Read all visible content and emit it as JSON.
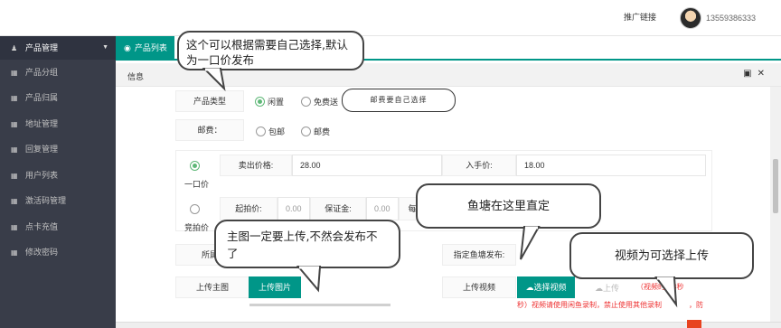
{
  "header": {
    "promo_link": "推广链接",
    "phone": "13559386333"
  },
  "sidebar": {
    "head": "产品管理",
    "items": [
      {
        "label": "产品分组"
      },
      {
        "label": "产品归属"
      },
      {
        "label": "地址管理"
      },
      {
        "label": "回复管理"
      },
      {
        "label": "用户列表"
      },
      {
        "label": "激活码管理"
      },
      {
        "label": "点卡充值"
      },
      {
        "label": "修改密码"
      }
    ]
  },
  "tabs": {
    "active": "产品列表"
  },
  "panel": {
    "title": "信息"
  },
  "form": {
    "product_type": {
      "label": "产品类型",
      "options": [
        "闲置",
        "免费送"
      ],
      "selected": "闲置"
    },
    "postage_button": "邮费要自己选择",
    "postage": {
      "label": "邮费：",
      "options": [
        "包邮",
        "邮费"
      ]
    },
    "fixed_price": {
      "radio_label": "一口价",
      "sell_price_label": "卖出价格:",
      "sell_price": "28.00",
      "received_label": "入手价:",
      "received": "18.00"
    },
    "auction": {
      "radio_label": "竞拍价",
      "start_label": "起拍价:",
      "start": "0.00",
      "deposit_label": "保证金:",
      "deposit": "0.00",
      "step_label_partial": "每"
    },
    "belongs_label_partial": "所属",
    "pond_label": "指定鱼塘发布:",
    "upload_main_label": "上传主图",
    "upload_image_button": "上传图片",
    "upload_video_label": "上传视频",
    "select_video_button": "选择视频",
    "upload_button": "上传",
    "video_note_1": "（视频时长3秒",
    "video_note_2": "秒）视频请使用闲鱼录制，禁止使用其他录制",
    "video_note_3": "，防"
  },
  "annotations": {
    "select_price": "这个可以根据需要自己选择,默认为一口价发布",
    "pond": "鱼塘在这里直定",
    "main_image": "主图一定要上传,不然会发布不了",
    "video": "视频为可选择上传"
  },
  "colors": {
    "accent": "#009688",
    "sidebar": "#393d49",
    "radio_on": "#5fb878",
    "note": "#e33333"
  }
}
